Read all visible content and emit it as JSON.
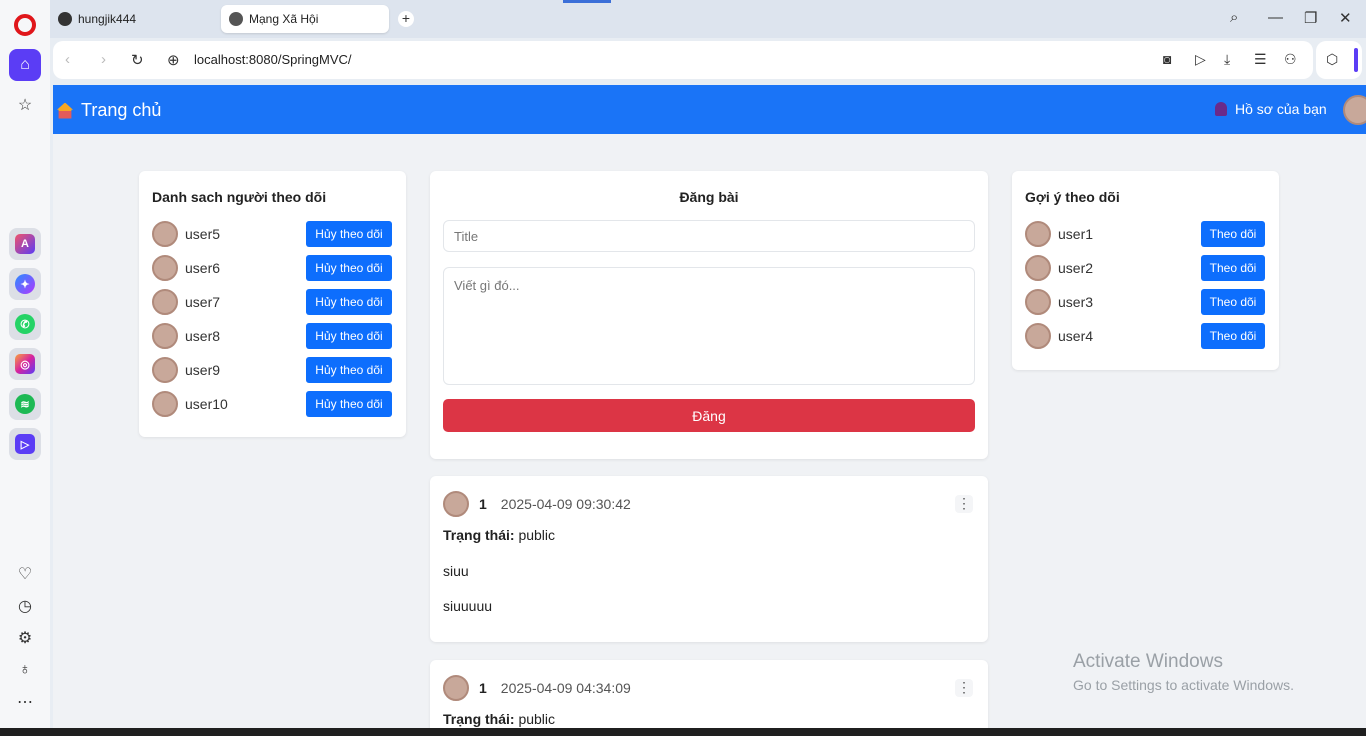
{
  "browser": {
    "tabs": [
      {
        "label": "hungjik444",
        "active": false
      },
      {
        "label": "Mạng Xã Hội",
        "active": true
      }
    ],
    "new_tab": "+",
    "url": "localhost:8080/SpringMVC/"
  },
  "navbar": {
    "brand": "Trang chủ",
    "profile_link": "Hồ sơ của bạn"
  },
  "followers": {
    "title": "Danh sach người theo dõi",
    "users": [
      {
        "name": "user5",
        "action": "Hủy theo dõi"
      },
      {
        "name": "user6",
        "action": "Hủy theo dõi"
      },
      {
        "name": "user7",
        "action": "Hủy theo dõi"
      },
      {
        "name": "user8",
        "action": "Hủy theo dõi"
      },
      {
        "name": "user9",
        "action": "Hủy theo dõi"
      },
      {
        "name": "user10",
        "action": "Hủy theo dõi"
      }
    ]
  },
  "compose": {
    "title": "Đăng bài",
    "title_placeholder": "Title",
    "body_placeholder": "Viết gì đó...",
    "submit_label": "Đăng"
  },
  "posts": [
    {
      "author": "1",
      "date": "2025-04-09 09:30:42",
      "status_label": "Trạng thái:",
      "status_value": "public",
      "title": "siuu",
      "content": "siuuuuu"
    },
    {
      "author": "1",
      "date": "2025-04-09 04:34:09",
      "status_label": "Trạng thái:",
      "status_value": "public"
    }
  ],
  "suggestions": {
    "title": "Gợi ý theo dõi",
    "users": [
      {
        "name": "user1",
        "action": "Theo dõi"
      },
      {
        "name": "user2",
        "action": "Theo dõi"
      },
      {
        "name": "user3",
        "action": "Theo dõi"
      },
      {
        "name": "user4",
        "action": "Theo dõi"
      }
    ]
  },
  "watermark": {
    "line1": "Activate Windows",
    "line2": "Go to Settings to activate Windows."
  },
  "colors": {
    "navbar": "#1a74f7",
    "primary_button": "#0d6efd",
    "submit_button": "#dc3545",
    "opera_accent": "#5b3df5"
  }
}
